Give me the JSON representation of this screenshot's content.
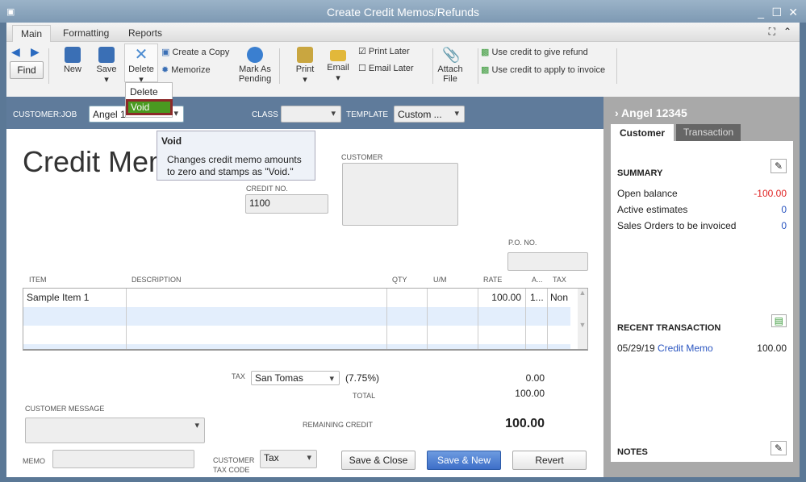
{
  "window": {
    "title": "Create Credit Memos/Refunds"
  },
  "tabs": [
    "Main",
    "Formatting",
    "Reports"
  ],
  "toolbar": {
    "find": "Find",
    "new": "New",
    "save": "Save",
    "delete": "Delete",
    "create_copy": "Create a Copy",
    "memorize": "Memorize",
    "mark_pending": "Mark As Pending",
    "print": "Print",
    "email": "Email",
    "print_later": "Print Later",
    "email_later": "Email Later",
    "attach": "Attach File",
    "refund": "Use credit to give refund",
    "apply": "Use credit to apply to invoice"
  },
  "delete_menu": {
    "items": [
      "Delete",
      "Void"
    ]
  },
  "tooltip": {
    "title": "Void",
    "text": "Changes credit memo amounts to zero and stamps as \"Void.\""
  },
  "header": {
    "customer_job_label": "CUSTOMER:JOB",
    "customer_job": "Angel 1",
    "class_label": "CLASS",
    "class": "",
    "template_label": "TEMPLATE",
    "template": "Custom ..."
  },
  "form": {
    "title": "Credit Memo",
    "credit_no_label": "CREDIT NO.",
    "credit_no": "1100",
    "customer_label": "CUSTOMER",
    "po_label": "P.O. NO.",
    "columns": [
      "ITEM",
      "DESCRIPTION",
      "QTY",
      "U/M",
      "RATE",
      "A...",
      "TAX"
    ],
    "rows": [
      [
        "Sample Item 1",
        "",
        "",
        "",
        "100.00",
        "1...",
        "Non"
      ]
    ],
    "tax_label": "TAX",
    "tax": "San Tomas",
    "tax_rate": "(7.75%)",
    "tax_amount": "0.00",
    "total_label": "TOTAL",
    "total": "100.00",
    "customer_message_label": "CUSTOMER MESSAGE",
    "remaining_label": "REMAINING CREDIT",
    "remaining": "100.00",
    "memo_label": "MEMO",
    "cust_tax_label1": "CUSTOMER",
    "cust_tax_label2": "TAX CODE",
    "cust_tax": "Tax",
    "save_close": "Save & Close",
    "save_new": "Save & New",
    "revert": "Revert"
  },
  "panel": {
    "name": "Angel 12345",
    "tabs": [
      "Customer",
      "Transaction"
    ],
    "summary": "SUMMARY",
    "items": [
      {
        "label": "Open balance",
        "value": "-100.00"
      },
      {
        "label": "Active estimates",
        "value": "0"
      },
      {
        "label": "Sales Orders to be invoiced",
        "value": "0"
      }
    ],
    "recent": "RECENT TRANSACTION",
    "recent_date": "05/29/19",
    "recent_type": "Credit Memo",
    "recent_amount": "100.00",
    "notes": "NOTES"
  }
}
